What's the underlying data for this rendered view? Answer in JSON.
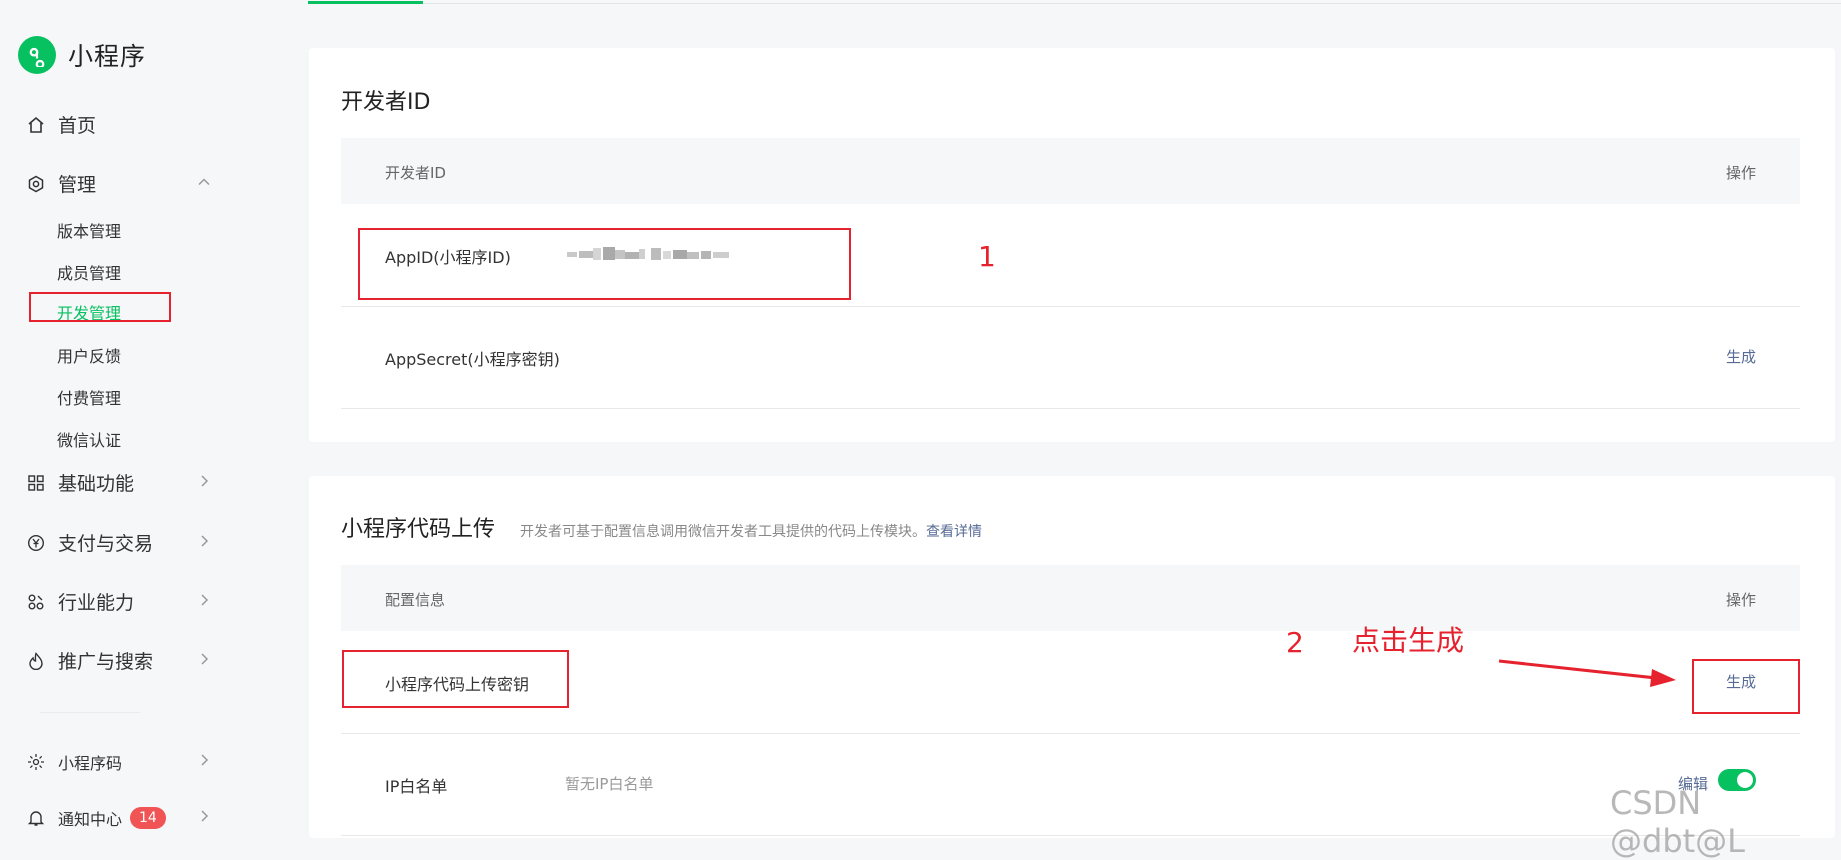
{
  "app": {
    "name": "小程序"
  },
  "sidebar": {
    "home": "首页",
    "manage": {
      "label": "管理",
      "children": [
        "版本管理",
        "成员管理",
        "开发管理",
        "用户反馈",
        "付费管理",
        "微信认证"
      ]
    },
    "basic": "基础功能",
    "pay": "支付与交易",
    "industry": "行业能力",
    "promo": "推广与搜索",
    "qrcode": "小程序码",
    "notify": {
      "label": "通知中心",
      "badge": "14"
    }
  },
  "dev_id_card": {
    "title": "开发者ID",
    "col_left": "开发者ID",
    "col_right": "操作",
    "rows": [
      {
        "label": "AppID(小程序ID)",
        "op": ""
      },
      {
        "label": "AppSecret(小程序密钥)",
        "op": "生成"
      }
    ]
  },
  "upload_card": {
    "title": "小程序代码上传",
    "desc": "开发者可基于配置信息调用微信开发者工具提供的代码上传模块。",
    "desc_link": "查看详情",
    "col_left": "配置信息",
    "col_right": "操作",
    "rows": [
      {
        "label": "小程序代码上传密钥",
        "op": "生成"
      },
      {
        "label": "IP白名单",
        "value": "暂无IP白名单",
        "op": "编辑"
      }
    ]
  },
  "annotations": {
    "step1": "1",
    "step2": "2",
    "step2_text": "点击生成"
  },
  "watermark": "CSDN @dbt@L",
  "colors": {
    "accent": "#07c160",
    "link": "#576b95",
    "annotation": "#e5222d"
  }
}
